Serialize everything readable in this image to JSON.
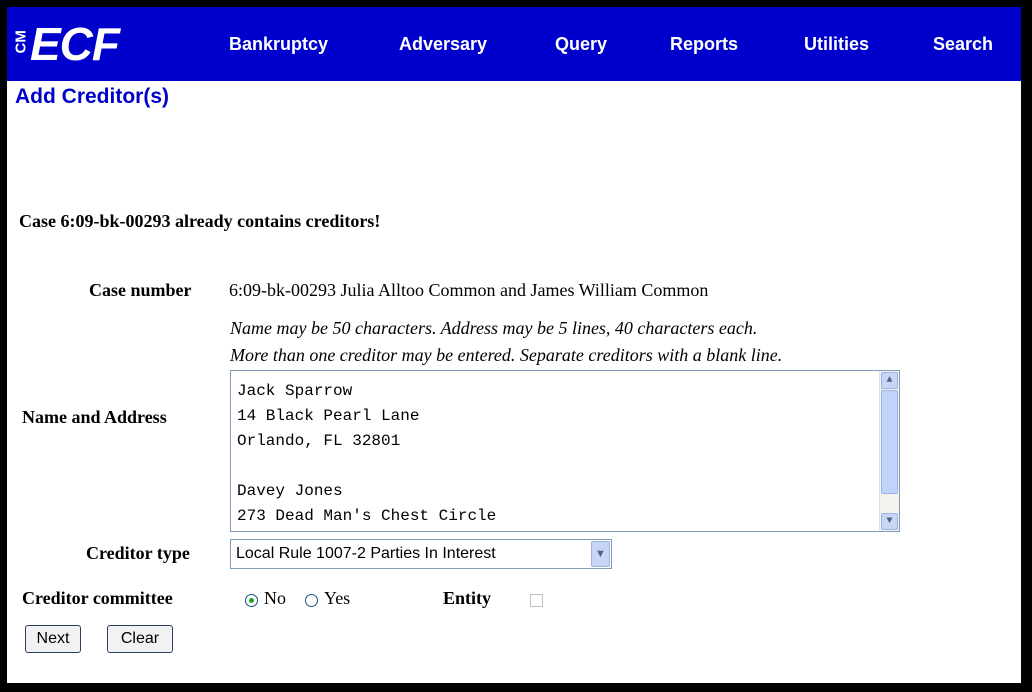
{
  "app": {
    "logo_small": "CM",
    "logo_large": "ECF"
  },
  "menu": {
    "items": [
      "Bankruptcy",
      "Adversary",
      "Query",
      "Reports",
      "Utilities",
      "Search"
    ]
  },
  "page": {
    "title": "Add Creditor(s)",
    "warning": "Case 6:09-bk-00293 already contains creditors!"
  },
  "form": {
    "case_number_label": "Case number",
    "case_number_value": "6:09-bk-00293 Julia Alltoo Common and James William Common",
    "hint_line1": "Name may be 50 characters. Address may be 5 lines, 40 characters each.",
    "hint_line2": "More than one creditor may be entered. Separate creditors with a blank line.",
    "name_address_label": "Name and Address",
    "name_address_lines": [
      "Jack Sparrow",
      "14 Black Pearl Lane",
      "Orlando, FL 32801",
      "",
      "Davey Jones",
      "273 Dead Man's Chest Circle"
    ],
    "creditor_type_label": "Creditor type",
    "creditor_type_value": "Local Rule 1007-2 Parties In Interest",
    "creditor_committee_label": "Creditor committee",
    "committee_options": [
      "No",
      "Yes"
    ],
    "committee_selected": "No",
    "entity_label": "Entity",
    "entity_checked": false,
    "next_label": "Next",
    "clear_label": "Clear"
  },
  "colors": {
    "menubar": "#0000cc",
    "title": "#0000cc"
  }
}
